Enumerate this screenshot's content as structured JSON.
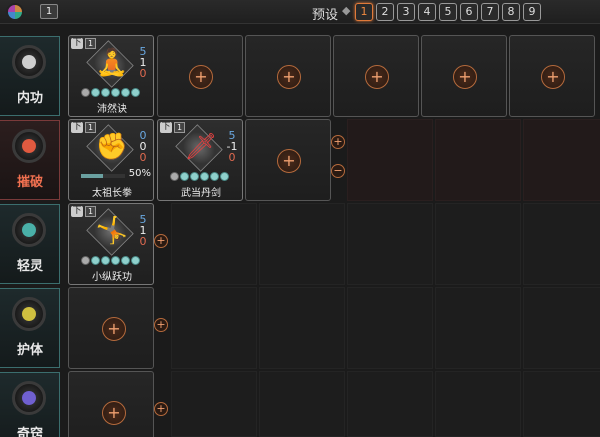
{
  "topbar": {
    "badge": "1",
    "preset_label": "预设",
    "preset_dot": "◆",
    "presets": [
      "1",
      "2",
      "3",
      "4",
      "5",
      "6",
      "7",
      "8",
      "9"
    ],
    "active_preset": "1"
  },
  "categories": [
    {
      "label": "内功",
      "color": "#cfcfcf"
    },
    {
      "label": "摧破",
      "color": "#e05a40"
    },
    {
      "label": "轻灵",
      "color": "#4ab0a8"
    },
    {
      "label": "护体",
      "color": "#d0c040"
    },
    {
      "label": "奇窍",
      "color": "#7060d0"
    }
  ],
  "skills": {
    "peiranjue": {
      "tier": "下",
      "level": "1",
      "stat1": "5",
      "stat2": "1",
      "stat3": "0",
      "name": "沛然诀",
      "glyph": "🧘",
      "stars_filled": 5,
      "stars_total": 6
    },
    "taizu": {
      "tier": "下",
      "level": "1",
      "stat1": "0",
      "stat2": "0",
      "stat3": "0",
      "name": "太祖长拳",
      "glyph": "✊",
      "progress": "50%"
    },
    "wudang": {
      "tier": "下",
      "level": "1",
      "stat1": "5",
      "stat2": "-1",
      "stat3": "0",
      "name": "武当丹剑",
      "glyph": "🗡",
      "stars_filled": 5,
      "stars_total": 6
    },
    "xiaozong": {
      "tier": "下",
      "level": "1",
      "stat1": "5",
      "stat2": "1",
      "stat3": "0",
      "name": "小纵跃功",
      "glyph": "🤸",
      "stars_filled": 5,
      "stars_total": 6
    }
  },
  "add_symbol": "+",
  "remove_symbol": "−"
}
